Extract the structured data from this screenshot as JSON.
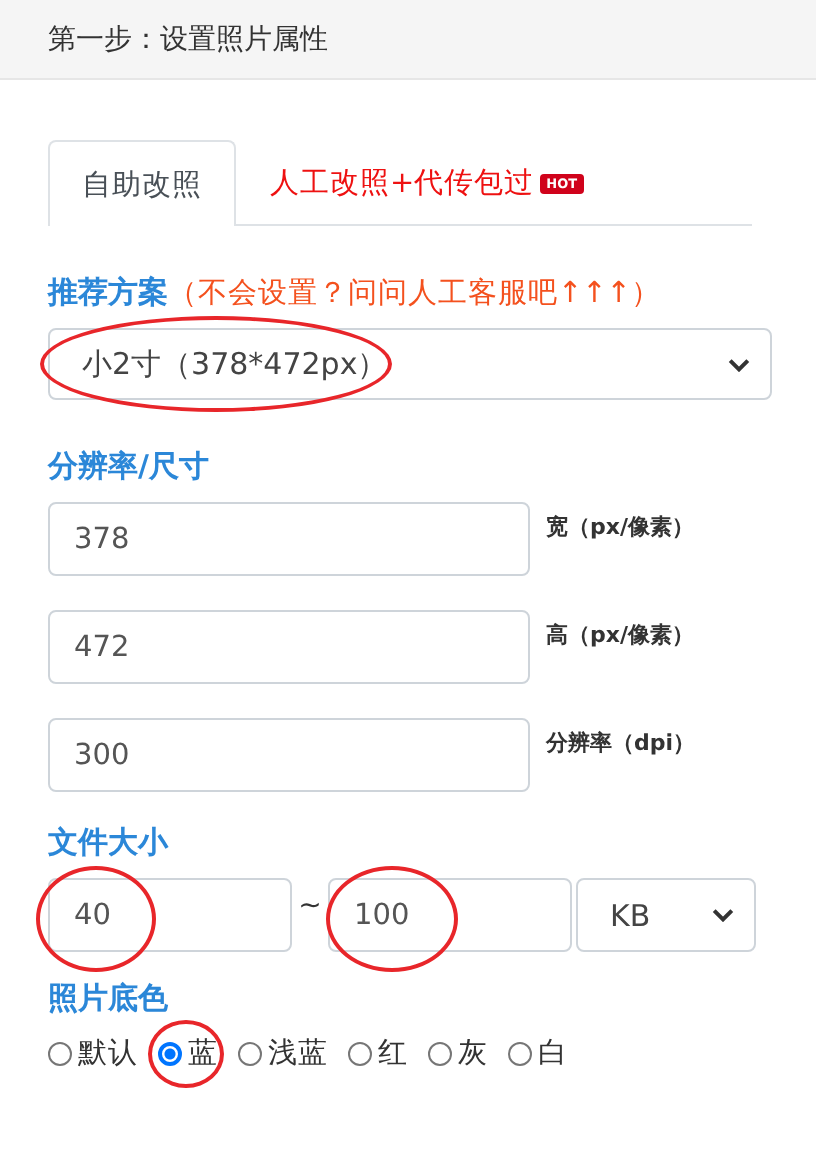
{
  "header": {
    "title": "第一步：设置照片属性"
  },
  "tabs": [
    {
      "label": "自助改照",
      "selected": true
    },
    {
      "label": "人工改照+代传包过",
      "selected": false,
      "badge": "HOT"
    }
  ],
  "recommend": {
    "label": "推荐方案",
    "hint": "（不会设置？问问人工客服吧↑↑↑）",
    "value": "小2寸（378*472px）",
    "circled": true
  },
  "resolution": {
    "label": "分辨率/尺寸",
    "fields": [
      {
        "value": "378",
        "unit": "宽（px/像素）"
      },
      {
        "value": "472",
        "unit": "高（px/像素）"
      },
      {
        "value": "300",
        "unit": "分辨率（dpi）"
      }
    ]
  },
  "file_size": {
    "label": "文件大小",
    "min": {
      "value": "40",
      "circled": true
    },
    "separator": "~",
    "max": {
      "value": "100",
      "circled": true
    },
    "unit": "KB"
  },
  "background": {
    "label": "照片底色",
    "options": [
      {
        "label": "默认",
        "selected": false,
        "circled": false
      },
      {
        "label": "蓝",
        "selected": true,
        "circled": true
      },
      {
        "label": "浅蓝",
        "selected": false,
        "circled": false
      },
      {
        "label": "红",
        "selected": false,
        "circled": false
      },
      {
        "label": "灰",
        "selected": false,
        "circled": false
      },
      {
        "label": "白",
        "selected": false,
        "circled": false
      }
    ]
  }
}
